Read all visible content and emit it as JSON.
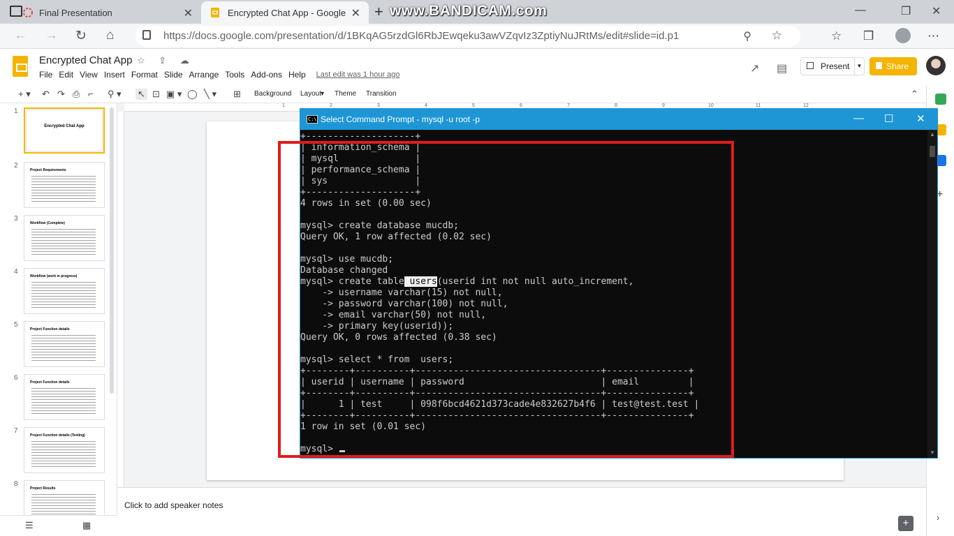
{
  "browser": {
    "tabs": [
      {
        "label": "Final Presentation"
      },
      {
        "label": "Encrypted Chat App - Google Sli"
      }
    ],
    "watermark": "www.BANDICAM.com",
    "url": "https://docs.google.com/presentation/d/1BKqAG5rzdGl6RbJEwqeku3awVZqvIz3ZptiyNuJRtMs/edit#slide=id.p1"
  },
  "slides_app": {
    "doc_title": "Encrypted Chat App",
    "menu": [
      "File",
      "Edit",
      "View",
      "Insert",
      "Format",
      "Slide",
      "Arrange",
      "Tools",
      "Add-ons",
      "Help"
    ],
    "last_edit": "Last edit was 1 hour ago",
    "present_label": "Present",
    "share_label": "Share",
    "toolbar": {
      "background": "Background",
      "layout": "Layout",
      "theme": "Theme",
      "transition": "Transition"
    },
    "thumbnails": [
      {
        "num": "1",
        "title": "Encrypted Chat App"
      },
      {
        "num": "2",
        "title": "Project Requirements"
      },
      {
        "num": "3",
        "title": "Workflow (Complete)"
      },
      {
        "num": "4",
        "title": "Workflow (work in progress)"
      },
      {
        "num": "5",
        "title": "Project Function details"
      },
      {
        "num": "6",
        "title": "Project Function details"
      },
      {
        "num": "7",
        "title": "Project Function details (Testing)"
      },
      {
        "num": "8",
        "title": "Project Results"
      }
    ],
    "notes_placeholder": "Click to add speaker notes"
  },
  "cmd": {
    "title": "Select Command Prompt - mysql  -u root -p",
    "lines": [
      "+--------------------+",
      "| information_schema |",
      "| mysql              |",
      "| performance_schema |",
      "| sys                |",
      "+--------------------+",
      "4 rows in set (0.00 sec)",
      "",
      "mysql> create database mucdb;",
      "Query OK, 1 row affected (0.02 sec)",
      "",
      "mysql> use mucdb;",
      "Database changed",
      "mysql> create table",
      "    -> username varchar(15) not null,",
      "    -> password varchar(100) not null,",
      "    -> email varchar(50) not null,",
      "    -> primary key(userid));",
      "Query OK, 0 rows affected (0.38 sec)",
      "",
      "mysql> select * from  users;",
      "+--------+----------+----------------------------------+---------------+",
      "| userid | username | password                         | email         |",
      "+--------+----------+----------------------------------+---------------+",
      "|      1 | test     | 098f6bcd4621d373cade4e832627b4f6 | test@test.test |",
      "+--------+----------+----------------------------------+---------------+",
      "1 row in set (0.01 sec)",
      "",
      "mysql> "
    ],
    "selected_word": " users",
    "after_selected": "(userid int not null auto_increment,"
  },
  "colors": {
    "slides_accent": "#f4b400",
    "cmd_titlebar": "#1e96d6",
    "annotation_box": "#e01b1b"
  }
}
